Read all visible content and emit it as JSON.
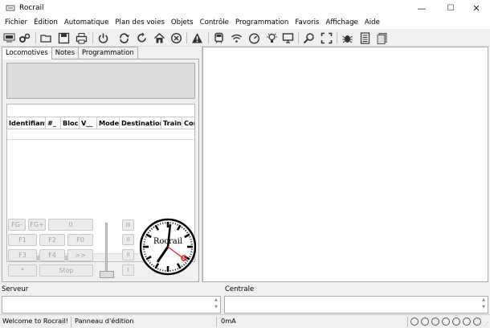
{
  "window": {
    "title": "Rocrail",
    "minimize": "—",
    "maximize": "☐",
    "close": "✕"
  },
  "menu": [
    "Fichier",
    "Édition",
    "Automatique",
    "Plan des voies",
    "Objets",
    "Contrôle",
    "Programmation",
    "Favoris",
    "Affichage",
    "Aide"
  ],
  "toolbar_icons": [
    "rocrail-connect-icon",
    "settings-icon",
    "open-folder-icon",
    "save-icon",
    "print-icon",
    "power-icon",
    "sync-icon",
    "reload-icon",
    "home-icon",
    "cancel-icon",
    "warning-icon",
    "train-icon",
    "wifi-icon",
    "speedometer-icon",
    "lightbulb-icon",
    "monitor-icon",
    "search-icon",
    "fullscreen-icon",
    "bug-icon",
    "list-icon",
    "documents-icon"
  ],
  "tabs": [
    "Locomotives",
    "Notes",
    "Programmation"
  ],
  "grid": {
    "columns": [
      "Identifiant",
      "#_",
      "Bloc",
      "V__",
      "Mode",
      "Destination",
      "Train",
      "Com"
    ]
  },
  "control": {
    "buttons": [
      [
        "FG-",
        "FG+",
        "0"
      ],
      [
        "F1",
        "F2",
        "F0"
      ],
      [
        "F3",
        "F4",
        ">>"
      ],
      [
        "*",
        "Stop"
      ]
    ],
    "side_buttons": [
      "III",
      "II",
      "II",
      "I"
    ]
  },
  "clock_brand": "Rocrail",
  "bottom": {
    "serveur_label": "Serveur",
    "centrale_label": "Centrale"
  },
  "status": {
    "message": "Welcome to Rocrail!",
    "mode": "Panneau d'édition",
    "current": "0mA"
  },
  "colors": {
    "accent_red": "#d42020"
  }
}
